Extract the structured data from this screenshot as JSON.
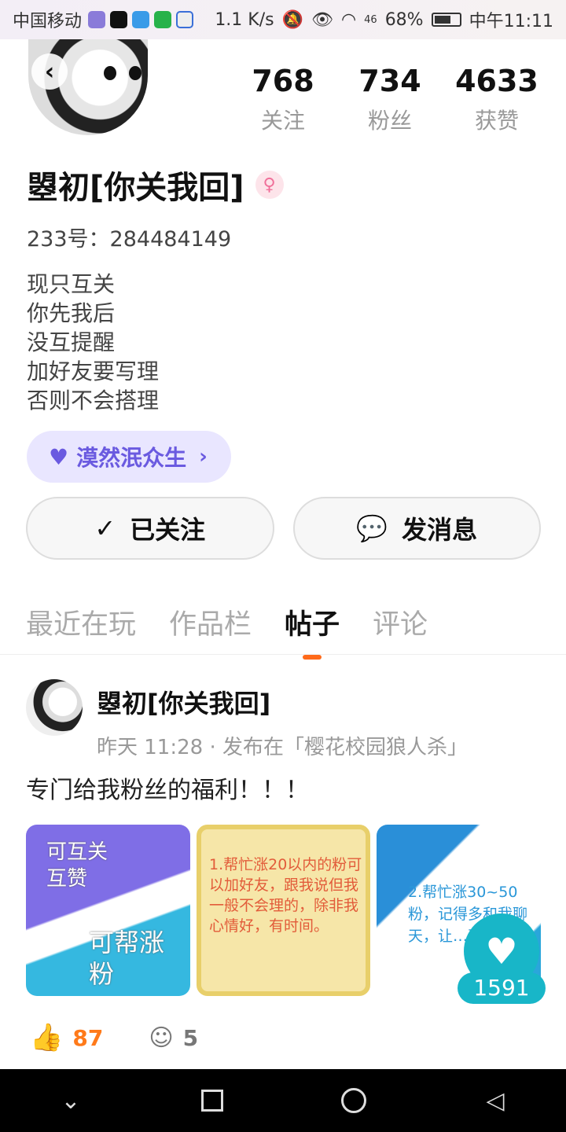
{
  "status_bar": {
    "carrier": "中国移动",
    "network_speed": "1.1 K/s",
    "signal": "46",
    "battery": "68%",
    "battery_level": 0.68,
    "time": "中午11:11"
  },
  "profile": {
    "stats": [
      {
        "value": "768",
        "label": "关注"
      },
      {
        "value": "734",
        "label": "粉丝"
      },
      {
        "value": "4633",
        "label": "获赞"
      }
    ],
    "name": "曌初[你关我回]",
    "uid": "233号：284484149",
    "bio": [
      "现只互关",
      "你先我后",
      "没互提醒",
      "加好友要写理",
      "否则不会搭理"
    ],
    "tag": "漠然泯众生"
  },
  "actions": {
    "follow_label": "已关注",
    "message_label": "发消息"
  },
  "tabs": [
    {
      "label": "最近在玩",
      "active": false
    },
    {
      "label": "作品栏",
      "active": false
    },
    {
      "label": "帖子",
      "active": true
    },
    {
      "label": "评论",
      "active": false
    }
  ],
  "post": {
    "author": "曌初[你关我回]",
    "meta": "昨天 11:28 · 发布在「樱花校园狼人杀」",
    "text": "专门给我粉丝的福利！！！",
    "images": [
      {
        "text": "可互关\n互赞",
        "text2": "可帮涨\n粉"
      },
      {
        "text": "1.帮忙涨20以内的粉可以加好友，跟我说但我一般不会理的，除非我心情好，有时间。"
      },
      {
        "text": "2.帮忙涨30~50粉，记得多和我聊天，让…到…"
      }
    ],
    "likes": "87",
    "comments": "5",
    "heart_count": "1591"
  }
}
